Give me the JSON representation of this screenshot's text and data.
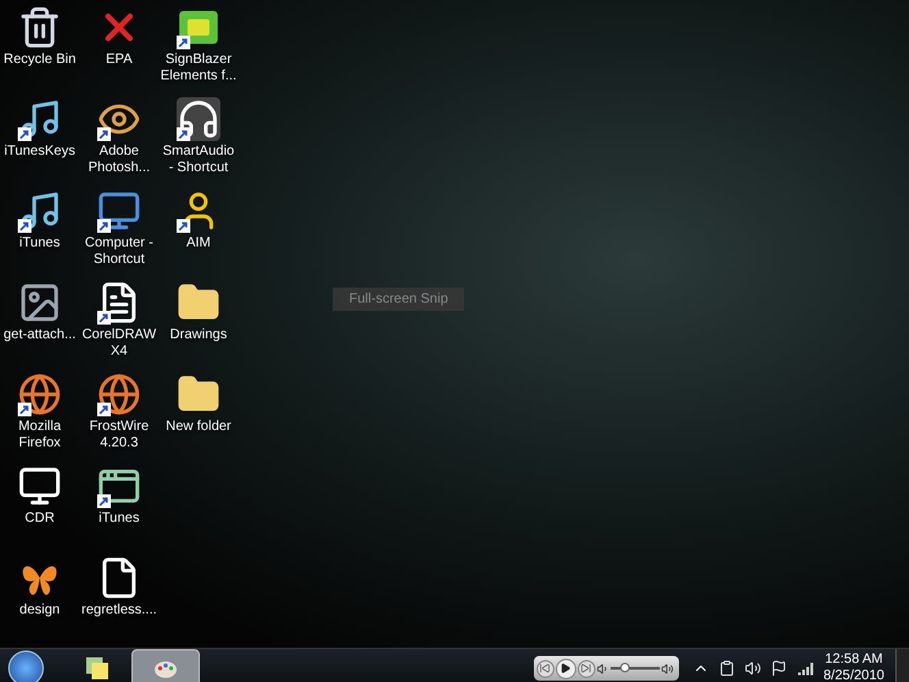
{
  "desktop_icons": [
    {
      "label": "Recycle Bin",
      "kind": "bin",
      "shortcut": false
    },
    {
      "label": "iTunesKeys",
      "kind": "music",
      "shortcut": true
    },
    {
      "label": "iTunes",
      "kind": "music",
      "shortcut": true
    },
    {
      "label": "get-attach...",
      "kind": "photo",
      "shortcut": false
    },
    {
      "label": "Mozilla Firefox",
      "kind": "globe",
      "shortcut": true
    },
    {
      "label": "CDR",
      "kind": "monitor",
      "shortcut": false
    },
    {
      "label": "design",
      "kind": "butterfly",
      "shortcut": false
    },
    {
      "label": "EPA",
      "kind": "cross",
      "shortcut": false
    },
    {
      "label": "Adobe Photosh...",
      "kind": "eye",
      "shortcut": true
    },
    {
      "label": "Computer - Shortcut",
      "kind": "computer",
      "shortcut": true
    },
    {
      "label": "CorelDRAW X4",
      "kind": "document",
      "shortcut": true
    },
    {
      "label": "FrostWire 4.20.3",
      "kind": "globe",
      "shortcut": true
    },
    {
      "label": "iTunes",
      "kind": "window",
      "shortcut": true
    },
    {
      "label": "regretless....",
      "kind": "blank",
      "shortcut": false
    },
    {
      "label": "SignBlazer Elements f...",
      "kind": "letters",
      "shortcut": true
    },
    {
      "label": "SmartAudio - Shortcut",
      "kind": "headphones",
      "shortcut": true
    },
    {
      "label": "AIM",
      "kind": "person",
      "shortcut": true
    },
    {
      "label": "Drawings",
      "kind": "folder",
      "shortcut": false
    },
    {
      "label": "New folder",
      "kind": "folder",
      "shortcut": false
    }
  ],
  "tooltip": "Full-screen Snip",
  "taskbar": {
    "buttons": [
      {
        "kind": "notes",
        "selected": false
      },
      {
        "kind": "paint",
        "selected": true
      }
    ],
    "media": {
      "volume": {
        "level": 0.3
      }
    },
    "clock": {
      "time": "12:58 AM",
      "date": "8/25/2010"
    }
  }
}
